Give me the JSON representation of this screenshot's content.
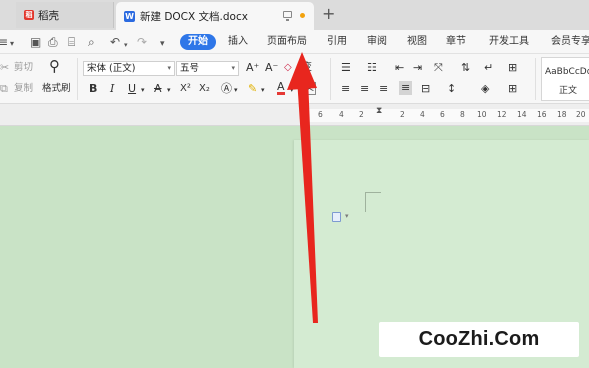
{
  "tabs": {
    "straw_label": "稻壳",
    "doc_title": "新建 DOCX 文档.docx",
    "new_tab": "+"
  },
  "quick_access": {
    "more": "≡",
    "save": "🖫",
    "undo": "↶",
    "redo": "↷",
    "overflow": "▾"
  },
  "menu": {
    "items": [
      "开始",
      "插入",
      "页面布局",
      "引用",
      "审阅",
      "视图",
      "章节",
      "开发工具",
      "会员专享"
    ]
  },
  "ribbon": {
    "cut": "剪切",
    "copy": "复制",
    "format_painter": "格式刷",
    "font_name": "宋体 (正文)",
    "font_size": "五号",
    "bold": "B",
    "italic": "I",
    "underline": "U",
    "strike": "A",
    "superscript": "X²",
    "subscript": "X₂",
    "font_color": "A",
    "style_preview": "AaBbCcDd",
    "style_name": "正文",
    "grow_font": "A⁺",
    "shrink_font": "A⁻",
    "wen": "文",
    "phonetic": "变"
  },
  "ruler": {
    "ticks": [
      "6",
      "4",
      "2",
      "2",
      "4",
      "6",
      "8",
      "10",
      "12",
      "14",
      "16",
      "18",
      "20"
    ]
  },
  "colors": {
    "accent": "#2e76e8",
    "workspace": "#c9e3c6",
    "arrow": "#e8261e"
  },
  "watermark": {
    "text": "CooZhi.Com"
  }
}
